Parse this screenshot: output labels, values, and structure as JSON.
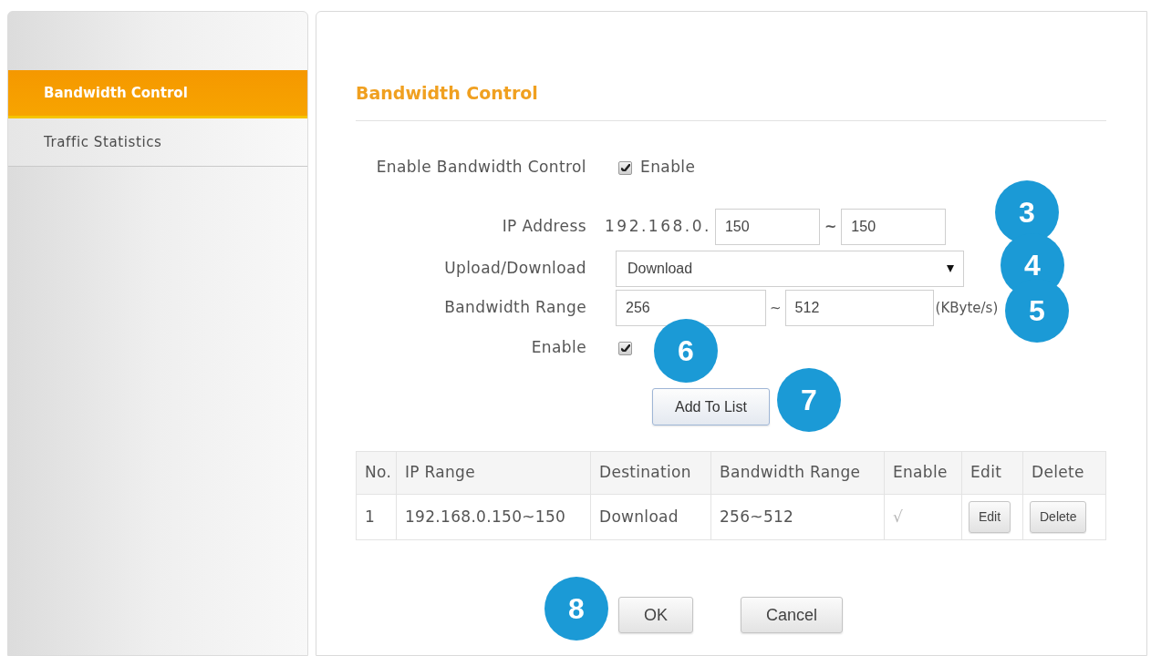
{
  "sidebar": {
    "items": [
      {
        "label": "Bandwidth Control",
        "selected": true
      },
      {
        "label": "Traffic Statistics",
        "selected": false
      }
    ]
  },
  "panel": {
    "title": "Bandwidth Control",
    "form": {
      "enable_bandwidth_control": {
        "label": "Enable Bandwidth Control",
        "checked": true,
        "option": "Enable"
      },
      "ip_address": {
        "label": "IP Address",
        "prefix": "192.168.0.",
        "from": "150",
        "separator": "~",
        "to": "150"
      },
      "upload_download": {
        "label": "Upload/Download",
        "value": "Download"
      },
      "bandwidth_range": {
        "label": "Bandwidth Range",
        "from": "256",
        "separator": "~",
        "to": "512",
        "unit": "(KByte/s)"
      },
      "enable": {
        "label": "Enable",
        "checked": true
      }
    },
    "add_button": "Add To List",
    "table": {
      "columns": [
        "No.",
        "IP Range",
        "Destination",
        "Bandwidth Range",
        "Enable",
        "Edit",
        "Delete"
      ],
      "rows": [
        {
          "cells": [
            {
              "kind": "text",
              "text": "1"
            },
            {
              "kind": "text",
              "text": "192.168.0.150~150"
            },
            {
              "kind": "text",
              "text": "Download"
            },
            {
              "kind": "text",
              "text": "256~512"
            },
            {
              "kind": "tick",
              "text": "√"
            },
            {
              "kind": "button",
              "text": "Edit"
            },
            {
              "kind": "button",
              "text": "Delete"
            }
          ]
        }
      ]
    },
    "buttons": [
      "OK",
      "Cancel"
    ]
  },
  "callouts": [
    "3",
    "4",
    "5",
    "6",
    "7",
    "8"
  ]
}
